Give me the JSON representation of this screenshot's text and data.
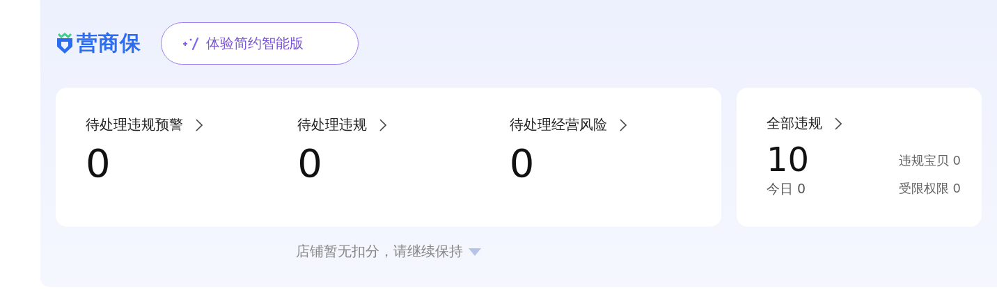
{
  "brand": {
    "name": "营商保"
  },
  "header_button": {
    "label": "体验简约智能版"
  },
  "pending": [
    {
      "label": "待处理违规预警",
      "value": "0"
    },
    {
      "label": "待处理违规",
      "value": "0"
    },
    {
      "label": "待处理经营风险",
      "value": "0"
    }
  ],
  "all_violations": {
    "label": "全部违规",
    "value": "10",
    "today": "今日 0",
    "details": [
      "违规宝贝 0",
      "受限权限 0"
    ]
  },
  "footer": {
    "text": "店铺暂无扣分，请继续保持"
  }
}
